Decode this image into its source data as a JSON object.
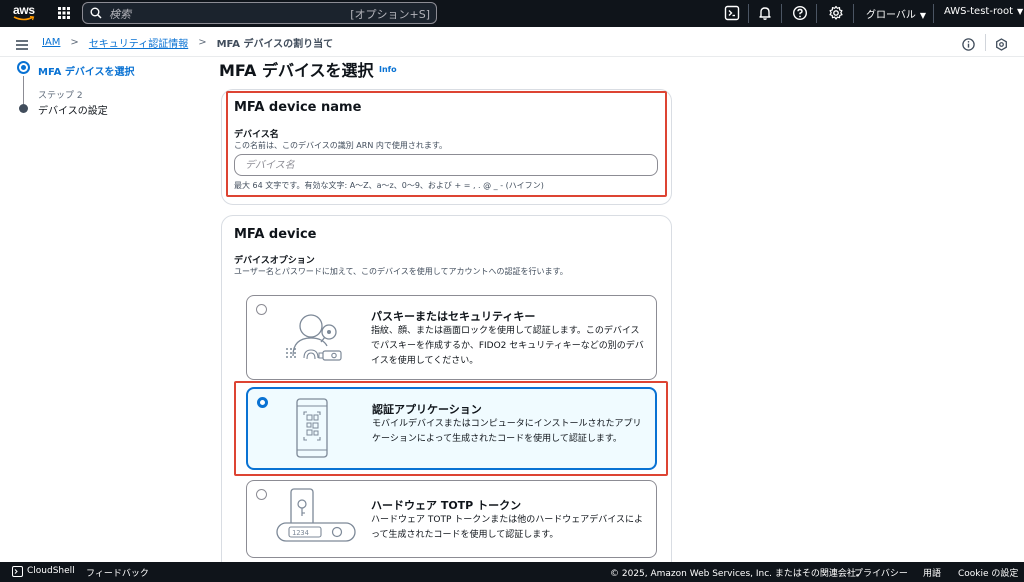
{
  "topbar": {
    "logo_text": "aws",
    "search_placeholder": "検索",
    "search_shortcut": "[オプション+S]",
    "region": "グローバル",
    "account": "AWS-test-root",
    "icons": [
      "apps-grid-icon",
      "cloudshell-icon",
      "bell-icon",
      "help-icon",
      "gear-icon"
    ]
  },
  "breadcrumb": {
    "items": [
      "IAM",
      "セキュリティ認証情報",
      "MFA デバイスの割り当て"
    ]
  },
  "steps": {
    "step1_label": "MFA デバイスを選択",
    "step2_caption": "ステップ 2",
    "step2_label": "デバイスの設定"
  },
  "page": {
    "title": "MFA デバイスを選択",
    "info": "Info"
  },
  "device_name": {
    "section_title": "MFA device name",
    "label": "デバイス名",
    "description": "この名前は、このデバイスの識別 ARN 内で使用されます。",
    "placeholder": "デバイス名",
    "value": "",
    "constraint": "最大 64 文字です。有効な文字: A〜Z、a〜z、0〜9、および + = , . @ _ - (ハイフン)"
  },
  "mfa_device": {
    "section_title": "MFA device",
    "label": "デバイスオプション",
    "description": "ユーザー名とパスワードに加えて、このデバイスを使用してアカウントへの認証を行います。",
    "selected": "authenticator",
    "options": [
      {
        "id": "passkey",
        "title": "パスキーまたはセキュリティキー",
        "description": "指紋、顔、または画面ロックを使用して認証します。このデバイスでパスキーを作成するか、FIDO2 セキュリティキーなどの別のデバイスを使用してください。",
        "icon": "passkey-illustration-icon"
      },
      {
        "id": "authenticator",
        "title": "認証アプリケーション",
        "description": "モバイルデバイスまたはコンピュータにインストールされたアプリケーションによって生成されたコードを使用して認証します。",
        "icon": "qr-phone-illustration-icon"
      },
      {
        "id": "totp",
        "title": "ハードウェア TOTP トークン",
        "description": "ハードウェア TOTP トークンまたは他のハードウェアデバイスによって生成されたコードを使用して認証します。",
        "icon": "totp-token-illustration-icon",
        "token_digits": "1234"
      }
    ]
  },
  "footer": {
    "cloudshell": "CloudShell",
    "feedback": "フィードバック",
    "copyright": "© 2025, Amazon Web Services, Inc. またはその関連会社。",
    "privacy": "プライバシー",
    "terms": "用語",
    "cookie": "Cookie の設定"
  },
  "colors": {
    "topbar_bg": "#0f141a",
    "link": "#0972d3",
    "highlight_border": "#dd4433",
    "selected_tile_bg": "#f0fbff"
  }
}
